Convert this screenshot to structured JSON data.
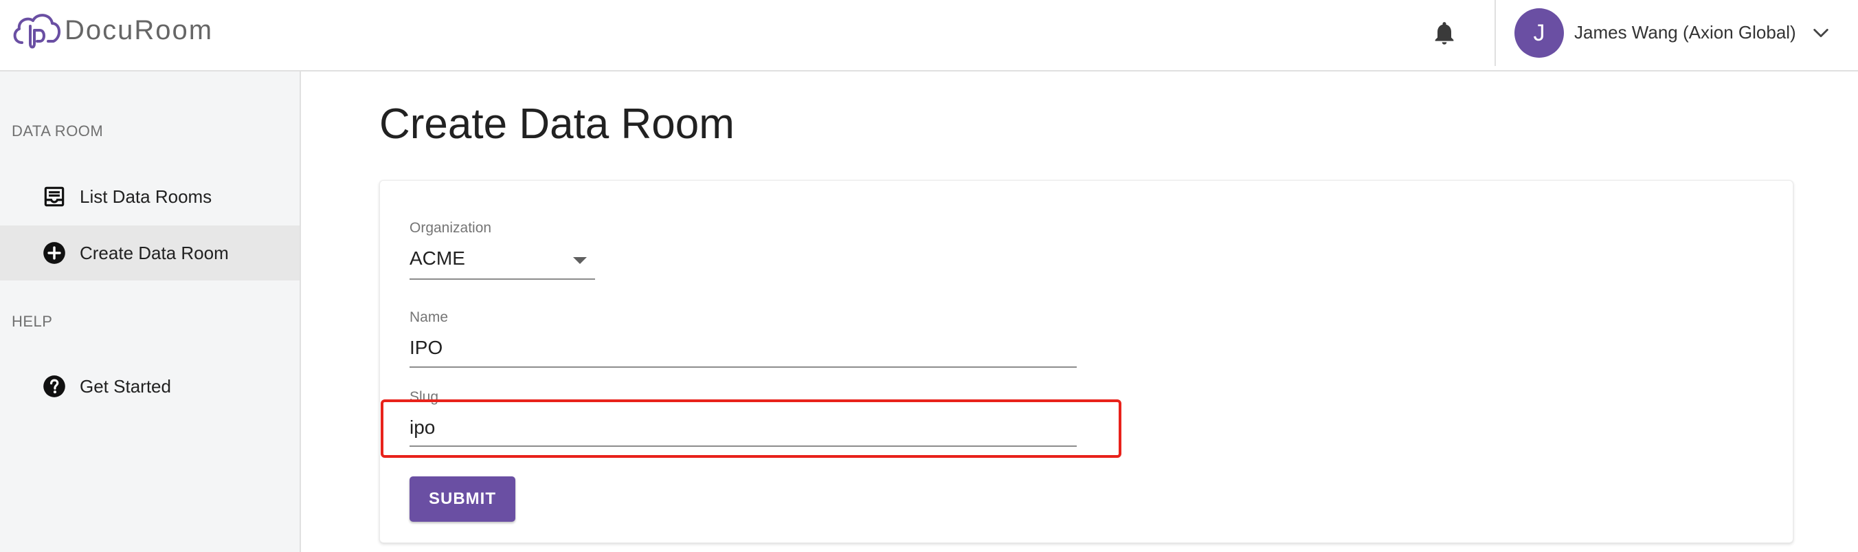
{
  "app": {
    "name": "DocuRoom"
  },
  "header": {
    "user_initial": "J",
    "user_name": "James Wang (Axion Global)"
  },
  "sidebar": {
    "sections": [
      {
        "label": "DATA ROOM"
      },
      {
        "label": "HELP"
      }
    ],
    "items": [
      {
        "label": "List Data Rooms",
        "icon": "inbox-tray-icon"
      },
      {
        "label": "Create Data Room",
        "icon": "add-circle-icon",
        "active": true
      },
      {
        "label": "Get Started",
        "icon": "help-circle-icon"
      }
    ]
  },
  "main": {
    "title": "Create Data Room",
    "form": {
      "organization": {
        "label": "Organization",
        "value": "ACME"
      },
      "name": {
        "label": "Name",
        "value": "IPO"
      },
      "slug": {
        "label": "Slug",
        "value": "ipo"
      },
      "submit_label": "SUBMIT"
    }
  },
  "colors": {
    "accent": "#6a4fa3",
    "highlight": "#e8221b",
    "sidebar_bg": "#f4f5f6",
    "active_item_bg": "#e7e7e7"
  }
}
